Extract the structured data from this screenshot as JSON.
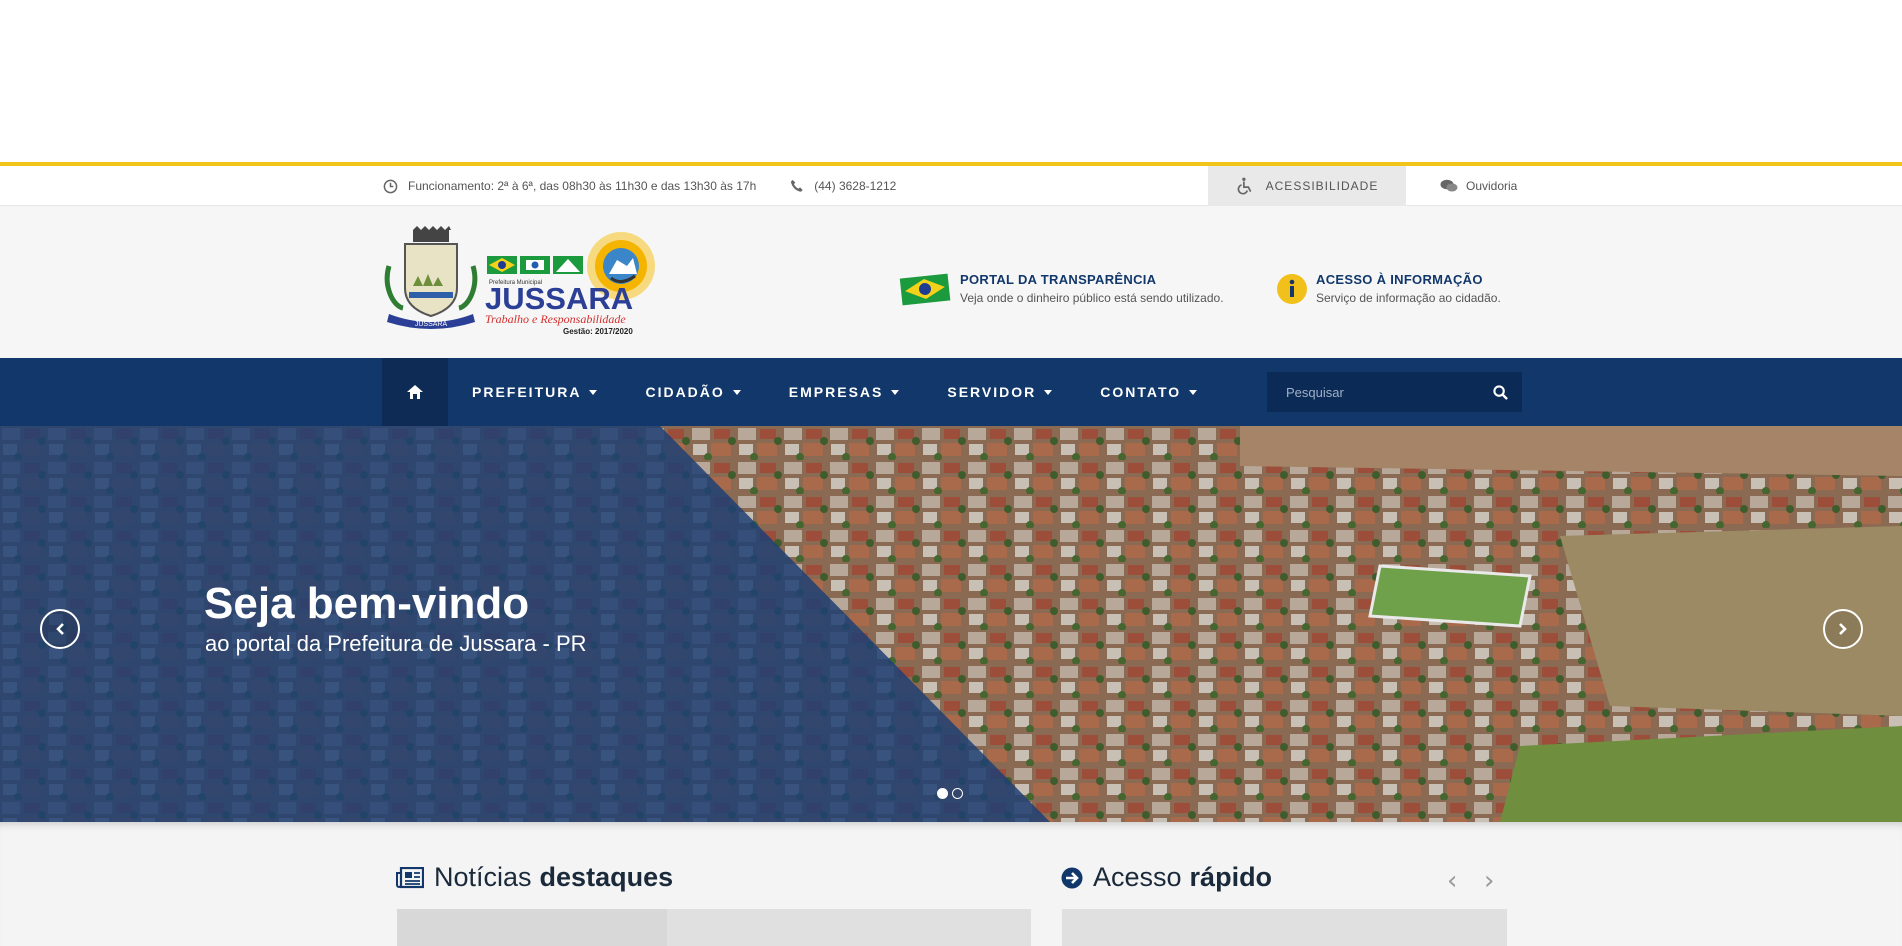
{
  "infobar": {
    "hours": "Funcionamento: 2ª à 6ª, das 08h30 às 11h30 e das 13h30 às 17h",
    "phone": "(44) 3628-1212",
    "accessibility": "ACESSIBILIDADE",
    "ouvidoria": "Ouvidoria"
  },
  "logo": {
    "small": "Prefeitura Municipal",
    "name": "JUSSARA",
    "slogan": "Trabalho e Responsabilidade",
    "term": "Gestão: 2017/2020",
    "ribbon": "JUSSARA"
  },
  "promos": [
    {
      "title": "PORTAL DA TRANSPARÊNCIA",
      "subtitle": "Veja onde o dinheiro público está sendo utilizado."
    },
    {
      "title": "ACESSO À INFORMAÇÃO",
      "subtitle": "Serviço de informação ao cidadão."
    }
  ],
  "nav": {
    "items": [
      "PREFEITURA",
      "CIDADÃO",
      "EMPRESAS",
      "SERVIDOR",
      "CONTATO"
    ],
    "search_placeholder": "Pesquisar"
  },
  "hero": {
    "title": "Seja bem-vindo",
    "subtitle": "ao portal da Prefeitura de Jussara - PR",
    "slides": 2,
    "active_slide": 1
  },
  "sections": {
    "news": {
      "light": "Notícias",
      "bold": "destaques"
    },
    "quick": {
      "light": "Acesso",
      "bold": "rápido"
    }
  },
  "colors": {
    "navy": "#12386b",
    "gold": "#f0c419"
  }
}
